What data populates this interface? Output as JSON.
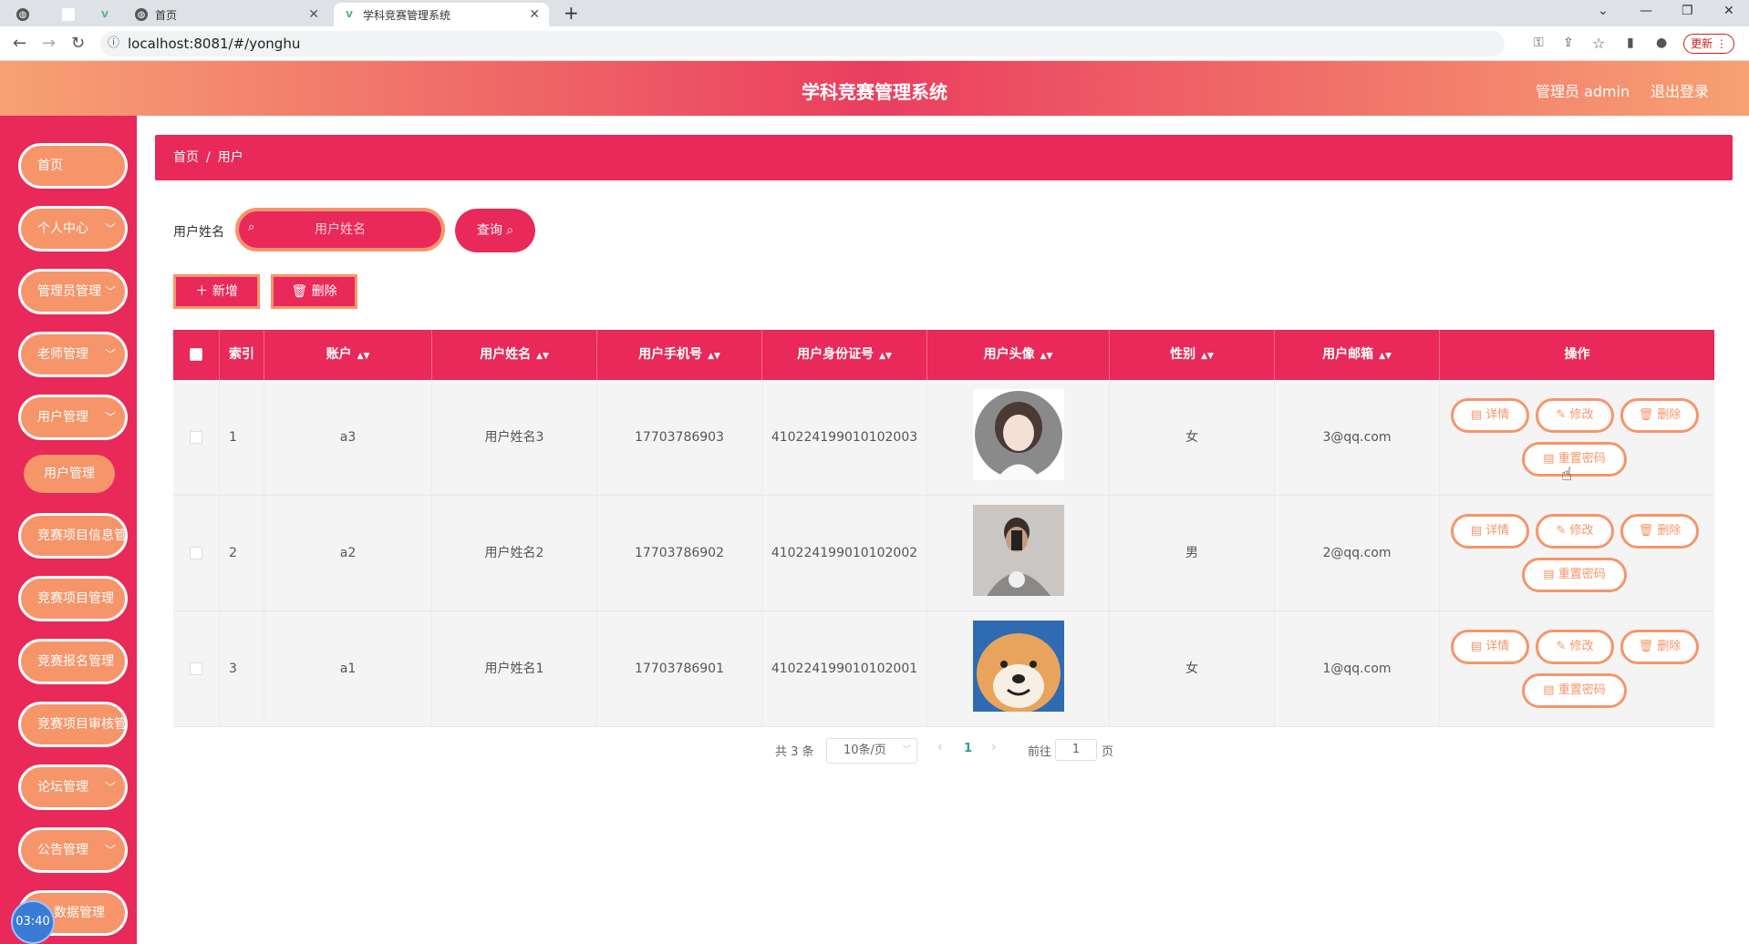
{
  "browser": {
    "tabs": [
      {
        "label": "",
        "icon": "globe-icon"
      },
      {
        "label": "",
        "icon": "blank-page-icon"
      },
      {
        "label": "",
        "icon": "vue-icon"
      },
      {
        "label": "首页",
        "icon": "globe-icon"
      },
      {
        "label": "学科竞赛管理系统",
        "icon": "vue-icon"
      }
    ],
    "new_tab": "+",
    "url": "localhost:8081/#/yonghu",
    "update_label": "更新"
  },
  "header": {
    "title": "学科竞赛管理系统",
    "admin": "管理员 admin",
    "logout": "退出登录"
  },
  "sidebar": {
    "items": [
      {
        "label": "首页"
      },
      {
        "label": "个人中心"
      },
      {
        "label": "管理员管理"
      },
      {
        "label": "老师管理"
      },
      {
        "label": "用户管理"
      },
      {
        "label": "竞赛项目信息管理"
      },
      {
        "label": "竞赛项目管理"
      },
      {
        "label": "竞赛报名管理"
      },
      {
        "label": "竞赛项目审核管理"
      },
      {
        "label": "论坛管理"
      },
      {
        "label": "公告管理"
      },
      {
        "label": "数据管理"
      }
    ],
    "sub_item": "用户管理",
    "clock": "03:40"
  },
  "breadcrumb": {
    "home": "首页",
    "sep": "/",
    "current": "用户"
  },
  "search": {
    "label": "用户姓名",
    "placeholder": "用户姓名",
    "button": "查询"
  },
  "actions": {
    "add": "新增",
    "delete": "删除"
  },
  "table": {
    "headers": [
      "索引",
      "账户",
      "用户姓名",
      "用户手机号",
      "用户身份证号",
      "用户头像",
      "性别",
      "用户邮箱",
      "操作"
    ],
    "rows": [
      {
        "index": "1",
        "account": "a3",
        "name": "用户姓名3",
        "phone": "17703786903",
        "idcard": "410224199010102003",
        "gender": "女",
        "email": "3@qq.com"
      },
      {
        "index": "2",
        "account": "a2",
        "name": "用户姓名2",
        "phone": "17703786902",
        "idcard": "410224199010102002",
        "gender": "男",
        "email": "2@qq.com"
      },
      {
        "index": "3",
        "account": "a1",
        "name": "用户姓名1",
        "phone": "17703786901",
        "idcard": "410224199010102001",
        "gender": "女",
        "email": "1@qq.com"
      }
    ],
    "ops": {
      "detail": "详情",
      "edit": "修改",
      "delete": "删除",
      "reset": "重置密码"
    }
  },
  "pagination": {
    "total": "共 3 条",
    "page_size": "10条/页",
    "current": "1",
    "goto_prefix": "前往",
    "goto_value": "1",
    "goto_suffix": "页"
  }
}
